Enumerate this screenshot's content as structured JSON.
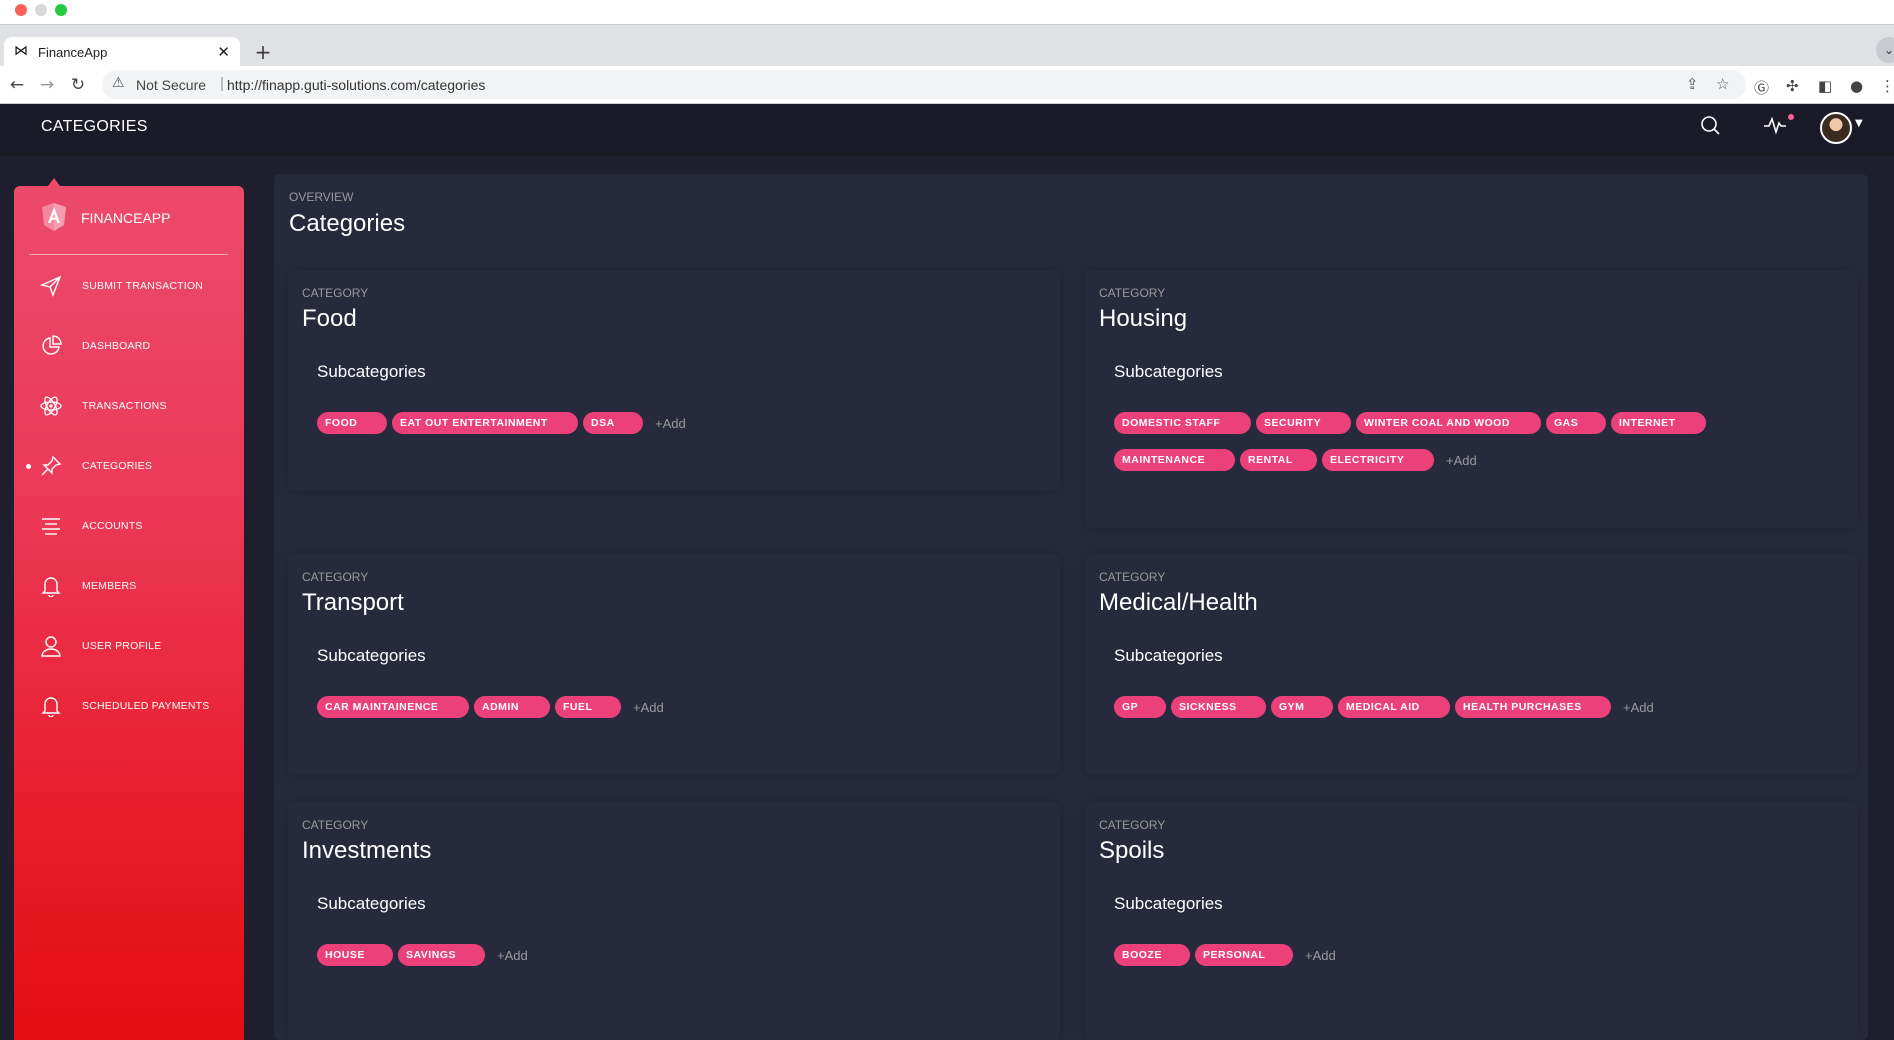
{
  "browser": {
    "tab_title": "FinanceApp",
    "tab_icon": "bow-tie-icon",
    "security_label": "Not Secure",
    "url": "http://finapp.guti-solutions.com/categories"
  },
  "header": {
    "title": "CATEGORIES"
  },
  "sidebar": {
    "brand": "FINANCEAPP",
    "active_index": 3,
    "items": [
      {
        "label": "SUBMIT TRANSACTION",
        "icon": "send-icon"
      },
      {
        "label": "DASHBOARD",
        "icon": "pie-chart-icon"
      },
      {
        "label": "TRANSACTIONS",
        "icon": "atom-icon"
      },
      {
        "label": "CATEGORIES",
        "icon": "pin-icon"
      },
      {
        "label": "ACCOUNTS",
        "icon": "align-icon"
      },
      {
        "label": "MEMBERS",
        "icon": "bell-icon"
      },
      {
        "label": "USER PROFILE",
        "icon": "user-icon"
      },
      {
        "label": "SCHEDULED PAYMENTS",
        "icon": "bell-icon"
      }
    ]
  },
  "main": {
    "overview_label": "OVERVIEW",
    "title": "Categories",
    "category_label": "CATEGORY",
    "subcategories_label": "Subcategories",
    "add_label": "+Add",
    "categories": [
      {
        "name": "Food",
        "subcategories": [
          "FOOD",
          "EAT OUT ENTERTAINMENT",
          "DSA"
        ]
      },
      {
        "name": "Housing",
        "subcategories": [
          "DOMESTIC STAFF",
          "SECURITY",
          "WINTER COAL AND WOOD",
          "GAS",
          "INTERNET",
          "MAINTENANCE",
          "RENTAL",
          "ELECTRICITY"
        ]
      },
      {
        "name": "Transport",
        "subcategories": [
          "CAR MAINTAINENCE",
          "ADMIN",
          "FUEL"
        ]
      },
      {
        "name": "Medical/Health",
        "subcategories": [
          "GP",
          "SICKNESS",
          "GYM",
          "MEDICAL AID",
          "HEALTH PURCHASES"
        ]
      },
      {
        "name": "Investments",
        "subcategories": [
          "HOUSE",
          "SAVINGS"
        ]
      },
      {
        "name": "Spoils",
        "subcategories": [
          "BOOZE",
          "PERSONAL"
        ]
      }
    ]
  },
  "colors": {
    "chip": "#ec407a",
    "sidebar_top": "#ec4a6b",
    "sidebar_bottom": "#e40d11",
    "background": "#1e1e2f",
    "card": "#27293d"
  }
}
